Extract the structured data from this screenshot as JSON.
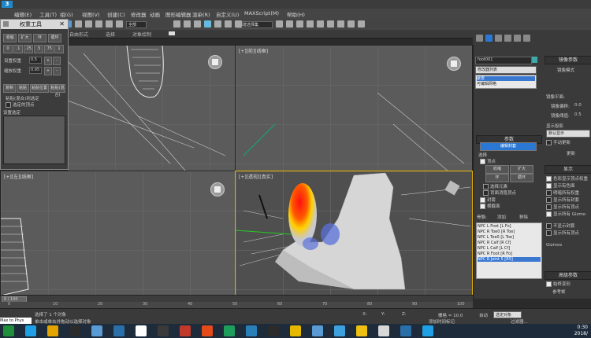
{
  "menubar": {
    "items": [
      "编辑(E)",
      "工具(T)",
      "组(G)",
      "视图(V)",
      "创建(C)",
      "修改器",
      "动画",
      "图形编辑器",
      "渲染(R)",
      "自定义(U)",
      "MAXScript(M)",
      "帮助(H)"
    ]
  },
  "toolbar": {
    "dropdown_all": "全部",
    "dropdown_view": "视图",
    "selection_set": "创建选择集"
  },
  "ribbon": {
    "items": [
      "自由形式",
      "选择",
      "对象绘制"
    ]
  },
  "floater": {
    "title": "权重工具",
    "buttons": [
      "收缩",
      "扩大",
      "环",
      "循环",
      "0",
      ".1",
      ".25",
      ".5",
      ".75",
      "1",
      "设置权重",
      "缩放权重",
      "复制",
      "粘贴",
      "粘贴位置"
    ],
    "label_weight": "设置权重",
    "label_scale": "缩放权重",
    "label_copy": "复制",
    "label_paste": "粘贴",
    "value1": "0.5",
    "value2": "0.95",
    "label_paste_pos": "粘贴位置",
    "label_blend": "粘贴(混合)",
    "label_vertex": "顶点",
    "label_tolerance": "粘贴(混合)到选定",
    "label_selected": "选定的顶点",
    "label_vertex_hint": "设置选定"
  },
  "viewports": {
    "top_left": "",
    "top_right": "[+][前][线框]",
    "bottom_left": "[+][左][线框]",
    "bottom_right": "[+][透视][真实]"
  },
  "cmdpanel": {
    "object_name": "foot001",
    "modifier_list": "修改器列表",
    "stack_items": [
      "蒙皮",
      "可编辑网格"
    ],
    "rollout_params": "参数",
    "edit_envelopes": "编辑封套",
    "select_label": "选择",
    "vertices": "顶点",
    "shrink": "收缩",
    "grow": "扩大",
    "ring": "环",
    "loop": "循环",
    "select_element": "选择元素",
    "backface_cull": "背面消隐顶点",
    "envelopes": "封套",
    "cross_sections": "横截面",
    "bones_label": "骨骼:",
    "add": "添加",
    "remove": "移除",
    "bones": [
      "NPC L Foot [L Fo]",
      "NPC R Toe0 [R Toe]",
      "NPC L Toe0 [L Toe]",
      "NPC R Calf [R Cf]",
      "NPC L Calf [L Cf]",
      "NPC R Foot [R Fo]",
      "NPC R Joint 5 [R5]"
    ],
    "right_header": "镜像参数",
    "mirror_mode": "镜像模式",
    "mirror_offset": "镜像平面:",
    "mirror_threshold": "镜像偏移:",
    "mirror_thresh2": "镜像阈值:",
    "display_projection": "显示投影",
    "default_display": "默认显示",
    "manual_update": "手动更新",
    "update": "更新",
    "display_header": "显示",
    "display_opts": [
      "色彩显示顶点权重",
      "显示有色面",
      "明暗所有权重",
      "显示所有封套",
      "显示所有顶点",
      "显示所有 Gizmo",
      "不显示封套",
      "显示所有顶点"
    ],
    "advanced_header": "高级参数",
    "gizmos_header": "Gizmos",
    "always_deform": "始终变形",
    "ref_frame": "参考帧",
    "back_transform": "向后变换顶点",
    "val1": "0.0",
    "val2": "0.1",
    "val3": "0.5"
  },
  "timeline": {
    "frame": "0 / 100",
    "ticks": [
      "0",
      "10",
      "20",
      "30",
      "40",
      "50",
      "60",
      "70",
      "80",
      "90",
      "100"
    ]
  },
  "status": {
    "script_left": "Max to Phys",
    "selected": "选择了 1 个对象",
    "hint": "单击或单击并拖动以选择对象",
    "x_label": "X:",
    "y_label": "Y:",
    "z_label": "Z:",
    "x": "0.0",
    "y": "0.0",
    "z": "0.0",
    "grid": "栅格 = 10.0",
    "add_time": "添加时间标记",
    "auto_key": "自动",
    "set_key": "选定对象",
    "filters": "过滤器...",
    "time": "0:30",
    "date": "2018/"
  },
  "colors": {
    "accent": "#2b78d4",
    "viewport_bg": "#5b5b5b",
    "taskbar": "#1d2b3a"
  }
}
